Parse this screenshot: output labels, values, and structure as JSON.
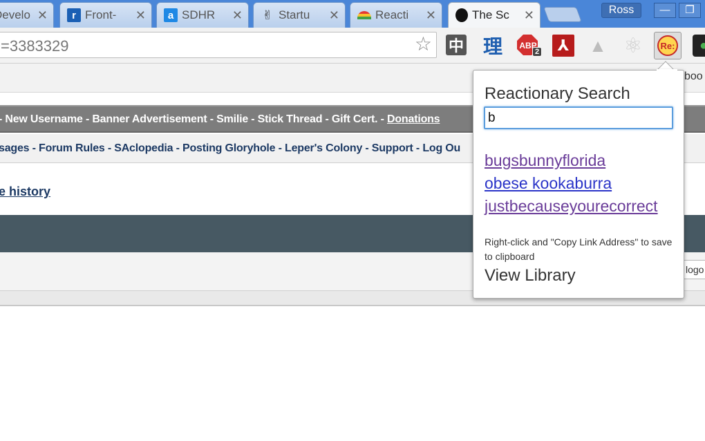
{
  "tabs": [
    {
      "title": "Develo",
      "favicon": "blank-page-icon",
      "active": false
    },
    {
      "title": "Front-",
      "favicon": "r-logo-icon",
      "active": false
    },
    {
      "title": "SDHR",
      "favicon": "a-logo-icon",
      "active": false
    },
    {
      "title": "Startu",
      "favicon": "peace-hand-icon",
      "active": false
    },
    {
      "title": "Reacti",
      "favicon": "rainbow-icon",
      "active": false
    },
    {
      "title": "The Sc",
      "favicon": "grenade-icon",
      "active": true
    }
  ],
  "tab_close_glyph": "✕",
  "window": {
    "profile_name": "Ross",
    "minimize": "—",
    "maximize": "❐"
  },
  "toolbar": {
    "url": "=3383329",
    "star_glyph": "☆",
    "extensions": [
      {
        "name": "zhong-icon",
        "glyph": "中"
      },
      {
        "name": "li-icon",
        "glyph": "理"
      },
      {
        "name": "adblock-plus-icon",
        "glyph": "ABP",
        "badge": "2"
      },
      {
        "name": "acrobat-icon",
        "glyph": "⅄"
      },
      {
        "name": "drive-icon",
        "glyph": "▲"
      },
      {
        "name": "atom-icon",
        "glyph": "⚛"
      },
      {
        "name": "reactionary-icon",
        "glyph": "Re:"
      },
      {
        "name": "green-icon",
        "glyph": "●"
      }
    ]
  },
  "bookmarks": {
    "partial_text": "boo"
  },
  "page": {
    "nav_primary": {
      "items": [
        "New Username",
        "Banner Advertisement",
        "Smilie",
        "Stick Thread",
        "Gift Cert.",
        "Donations"
      ],
      "separator": " - "
    },
    "nav_secondary": {
      "items": [
        "sages",
        "Forum Rules",
        "SAclopedia",
        "Posting Gloryhole",
        "Leper's Colony",
        "Support",
        "Log Ou"
      ],
      "separator": " - "
    },
    "history_link": "e history",
    "logout_partial": "logo"
  },
  "popup": {
    "title": "Reactionary Search",
    "search_value": "b",
    "results": [
      {
        "text": "bugsbunnyflorida",
        "visited": true
      },
      {
        "text": "obese kookaburra",
        "visited": false
      },
      {
        "text": "justbecauseyourecorrect",
        "visited": true
      }
    ],
    "hint": "Right-click and \"Copy Link Address\" to save to clipboard",
    "library_link": "View Library"
  },
  "colors": {
    "tabstrip": "#4a86d8",
    "nav_primary_bg": "#7d7d7d",
    "nav_link": "#1d3a64",
    "dark_bar": "#475963",
    "visited_link": "#6a3c99",
    "unvisited_link": "#2a34c8",
    "focus_ring": "#5b9ddd"
  }
}
